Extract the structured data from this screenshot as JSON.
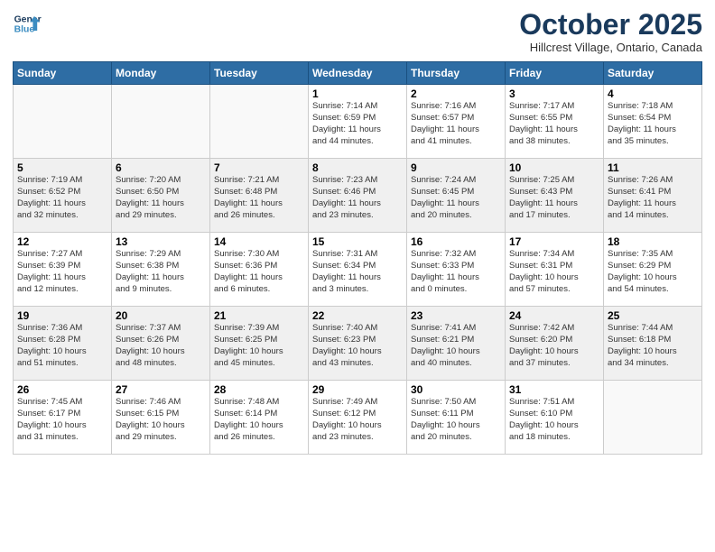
{
  "header": {
    "logo_line1": "General",
    "logo_line2": "Blue",
    "month": "October 2025",
    "location": "Hillcrest Village, Ontario, Canada"
  },
  "weekdays": [
    "Sunday",
    "Monday",
    "Tuesday",
    "Wednesday",
    "Thursday",
    "Friday",
    "Saturday"
  ],
  "weeks": [
    [
      {
        "day": "",
        "info": ""
      },
      {
        "day": "",
        "info": ""
      },
      {
        "day": "",
        "info": ""
      },
      {
        "day": "1",
        "info": "Sunrise: 7:14 AM\nSunset: 6:59 PM\nDaylight: 11 hours\nand 44 minutes."
      },
      {
        "day": "2",
        "info": "Sunrise: 7:16 AM\nSunset: 6:57 PM\nDaylight: 11 hours\nand 41 minutes."
      },
      {
        "day": "3",
        "info": "Sunrise: 7:17 AM\nSunset: 6:55 PM\nDaylight: 11 hours\nand 38 minutes."
      },
      {
        "day": "4",
        "info": "Sunrise: 7:18 AM\nSunset: 6:54 PM\nDaylight: 11 hours\nand 35 minutes."
      }
    ],
    [
      {
        "day": "5",
        "info": "Sunrise: 7:19 AM\nSunset: 6:52 PM\nDaylight: 11 hours\nand 32 minutes."
      },
      {
        "day": "6",
        "info": "Sunrise: 7:20 AM\nSunset: 6:50 PM\nDaylight: 11 hours\nand 29 minutes."
      },
      {
        "day": "7",
        "info": "Sunrise: 7:21 AM\nSunset: 6:48 PM\nDaylight: 11 hours\nand 26 minutes."
      },
      {
        "day": "8",
        "info": "Sunrise: 7:23 AM\nSunset: 6:46 PM\nDaylight: 11 hours\nand 23 minutes."
      },
      {
        "day": "9",
        "info": "Sunrise: 7:24 AM\nSunset: 6:45 PM\nDaylight: 11 hours\nand 20 minutes."
      },
      {
        "day": "10",
        "info": "Sunrise: 7:25 AM\nSunset: 6:43 PM\nDaylight: 11 hours\nand 17 minutes."
      },
      {
        "day": "11",
        "info": "Sunrise: 7:26 AM\nSunset: 6:41 PM\nDaylight: 11 hours\nand 14 minutes."
      }
    ],
    [
      {
        "day": "12",
        "info": "Sunrise: 7:27 AM\nSunset: 6:39 PM\nDaylight: 11 hours\nand 12 minutes."
      },
      {
        "day": "13",
        "info": "Sunrise: 7:29 AM\nSunset: 6:38 PM\nDaylight: 11 hours\nand 9 minutes."
      },
      {
        "day": "14",
        "info": "Sunrise: 7:30 AM\nSunset: 6:36 PM\nDaylight: 11 hours\nand 6 minutes."
      },
      {
        "day": "15",
        "info": "Sunrise: 7:31 AM\nSunset: 6:34 PM\nDaylight: 11 hours\nand 3 minutes."
      },
      {
        "day": "16",
        "info": "Sunrise: 7:32 AM\nSunset: 6:33 PM\nDaylight: 11 hours\nand 0 minutes."
      },
      {
        "day": "17",
        "info": "Sunrise: 7:34 AM\nSunset: 6:31 PM\nDaylight: 10 hours\nand 57 minutes."
      },
      {
        "day": "18",
        "info": "Sunrise: 7:35 AM\nSunset: 6:29 PM\nDaylight: 10 hours\nand 54 minutes."
      }
    ],
    [
      {
        "day": "19",
        "info": "Sunrise: 7:36 AM\nSunset: 6:28 PM\nDaylight: 10 hours\nand 51 minutes."
      },
      {
        "day": "20",
        "info": "Sunrise: 7:37 AM\nSunset: 6:26 PM\nDaylight: 10 hours\nand 48 minutes."
      },
      {
        "day": "21",
        "info": "Sunrise: 7:39 AM\nSunset: 6:25 PM\nDaylight: 10 hours\nand 45 minutes."
      },
      {
        "day": "22",
        "info": "Sunrise: 7:40 AM\nSunset: 6:23 PM\nDaylight: 10 hours\nand 43 minutes."
      },
      {
        "day": "23",
        "info": "Sunrise: 7:41 AM\nSunset: 6:21 PM\nDaylight: 10 hours\nand 40 minutes."
      },
      {
        "day": "24",
        "info": "Sunrise: 7:42 AM\nSunset: 6:20 PM\nDaylight: 10 hours\nand 37 minutes."
      },
      {
        "day": "25",
        "info": "Sunrise: 7:44 AM\nSunset: 6:18 PM\nDaylight: 10 hours\nand 34 minutes."
      }
    ],
    [
      {
        "day": "26",
        "info": "Sunrise: 7:45 AM\nSunset: 6:17 PM\nDaylight: 10 hours\nand 31 minutes."
      },
      {
        "day": "27",
        "info": "Sunrise: 7:46 AM\nSunset: 6:15 PM\nDaylight: 10 hours\nand 29 minutes."
      },
      {
        "day": "28",
        "info": "Sunrise: 7:48 AM\nSunset: 6:14 PM\nDaylight: 10 hours\nand 26 minutes."
      },
      {
        "day": "29",
        "info": "Sunrise: 7:49 AM\nSunset: 6:12 PM\nDaylight: 10 hours\nand 23 minutes."
      },
      {
        "day": "30",
        "info": "Sunrise: 7:50 AM\nSunset: 6:11 PM\nDaylight: 10 hours\nand 20 minutes."
      },
      {
        "day": "31",
        "info": "Sunrise: 7:51 AM\nSunset: 6:10 PM\nDaylight: 10 hours\nand 18 minutes."
      },
      {
        "day": "",
        "info": ""
      }
    ]
  ]
}
